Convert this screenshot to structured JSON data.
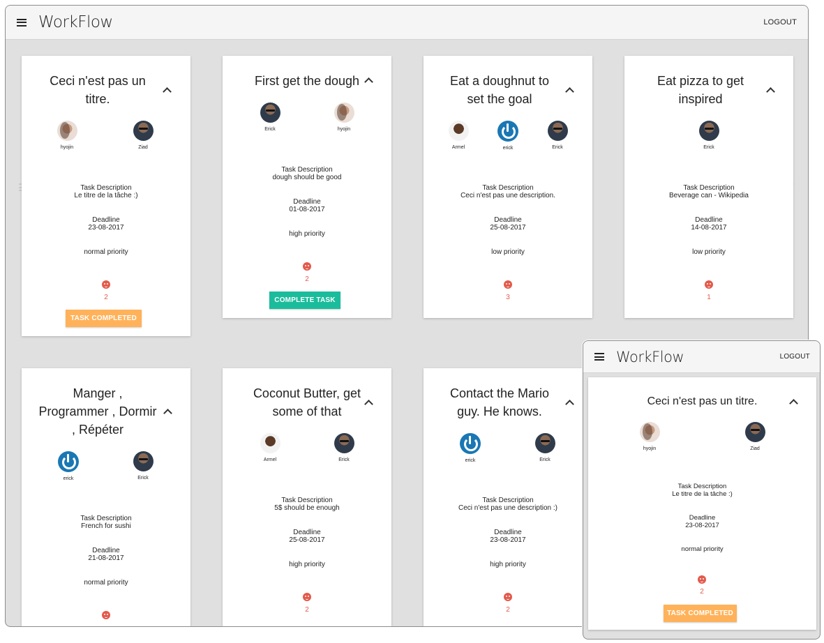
{
  "app": {
    "title": "WorkFlow",
    "logout": "LOGOUT",
    "menu_icon": "hamburger-icon"
  },
  "cards": [
    {
      "title_lines": [
        "Ceci n'est pas un",
        "titre."
      ],
      "members": [
        {
          "name": "hyojin",
          "avatar": "light"
        },
        {
          "name": "Ziad",
          "avatar": "dark"
        }
      ],
      "description_label": "Task Description",
      "description": "Le titre de la tâche :)",
      "deadline_label": "Deadline",
      "deadline": "23-08-2017",
      "priority": "normal priority",
      "likes": "2",
      "button": "TASK COMPLETED"
    },
    {
      "title_lines": [
        "First get the dough"
      ],
      "members": [
        {
          "name": "Erick",
          "avatar": "dark"
        },
        {
          "name": "hyojin",
          "avatar": "light"
        }
      ],
      "description_label": "Task Description",
      "description": "dough should be good",
      "deadline_label": "Deadline",
      "deadline": "01-08-2017",
      "priority": "high priority",
      "likes": "2",
      "button": "COMPLETE TASK"
    },
    {
      "title_lines": [
        "Eat a doughnut to",
        "set the goal"
      ],
      "members": [
        {
          "name": "Armel",
          "avatar": "darkskin"
        },
        {
          "name": "erick",
          "avatar": "power"
        },
        {
          "name": "Erick",
          "avatar": "dark"
        }
      ],
      "description_label": "Task Description",
      "description": "Ceci n'est pas une description.",
      "deadline_label": "Deadline",
      "deadline": "25-08-2017",
      "priority": "low priority",
      "likes": "3"
    },
    {
      "title_lines": [
        "Eat pizza to get",
        "inspired"
      ],
      "members": [
        {
          "name": "Erick",
          "avatar": "dark"
        }
      ],
      "description_label": "Task Description",
      "description": "Beverage can - Wikipedia",
      "deadline_label": "Deadline",
      "deadline": "14-08-2017",
      "priority": "low priority",
      "likes": "1"
    },
    {
      "title_lines": [
        "Manger ,",
        "Programmer , Dormir",
        ", Répéter"
      ],
      "members": [
        {
          "name": "erick",
          "avatar": "power"
        },
        {
          "name": "Erick",
          "avatar": "dark"
        }
      ],
      "description_label": "Task Description",
      "description": "French for sushi",
      "deadline_label": "Deadline",
      "deadline": "21-08-2017",
      "priority": "normal priority"
    },
    {
      "title_lines": [
        "Coconut Butter, get",
        "some of that"
      ],
      "members": [
        {
          "name": "Armel",
          "avatar": "darkskin"
        },
        {
          "name": "Erick",
          "avatar": "dark"
        }
      ],
      "description_label": "Task Description",
      "description": "5$ should be enough",
      "deadline_label": "Deadline",
      "deadline": "25-08-2017",
      "priority": "high priority",
      "likes": "2"
    },
    {
      "title_lines": [
        "Contact the Mario",
        "guy. He knows."
      ],
      "members": [
        {
          "name": "erick",
          "avatar": "power"
        },
        {
          "name": "Erick",
          "avatar": "dark"
        }
      ],
      "description_label": "Task Description",
      "description": "Ceci n'est pas une description :)",
      "deadline_label": "Deadline",
      "deadline": "23-08-2017",
      "priority": "high priority",
      "likes": "2"
    }
  ],
  "mobile": {
    "title": "WorkFlow",
    "logout": "LOGOUT",
    "card": {
      "title": "Ceci n'est pas un titre.",
      "members": [
        {
          "name": "hyojin",
          "avatar": "light"
        },
        {
          "name": "Ziad",
          "avatar": "dark"
        }
      ],
      "description_label": "Task Description",
      "description": "Le titre de la tâche :)",
      "deadline_label": "Deadline",
      "deadline": "23-08-2017",
      "priority": "normal priority",
      "likes": "2",
      "button": "TASK COMPLETED"
    }
  },
  "colors": {
    "accent_orange": "#ffb25a",
    "accent_teal": "#1bbc9c",
    "like_red": "#e35a4b",
    "avatar_blue": "#1a77b4",
    "background": "#e0e0e0"
  }
}
